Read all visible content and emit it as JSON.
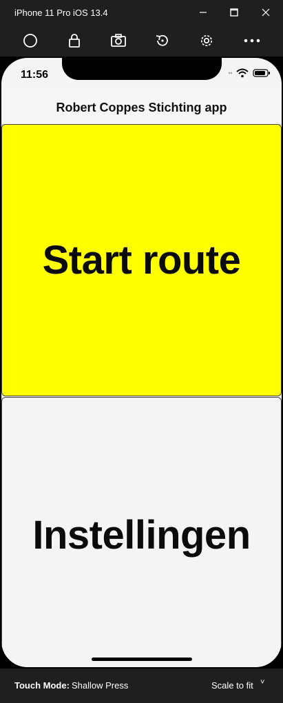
{
  "window": {
    "title": "iPhone 11 Pro iOS 13.4"
  },
  "toolbar": {
    "icons": [
      "home-icon",
      "lock-icon",
      "screenshot-icon",
      "rotate-icon",
      "settings-icon",
      "more-icon"
    ]
  },
  "status_bar": {
    "time": "11:56"
  },
  "app": {
    "nav_title": "Robert Coppes Stichting app",
    "start_label": "Start route",
    "settings_label": "Instellingen",
    "colors": {
      "start_tile": "#ffff00",
      "settings_tile": "#f4f4f4"
    }
  },
  "bottom_bar": {
    "touch_mode_label": "Touch Mode:",
    "touch_mode_value": "Shallow Press",
    "scale_label": "Scale to fit",
    "scale_chevron": "˅"
  }
}
